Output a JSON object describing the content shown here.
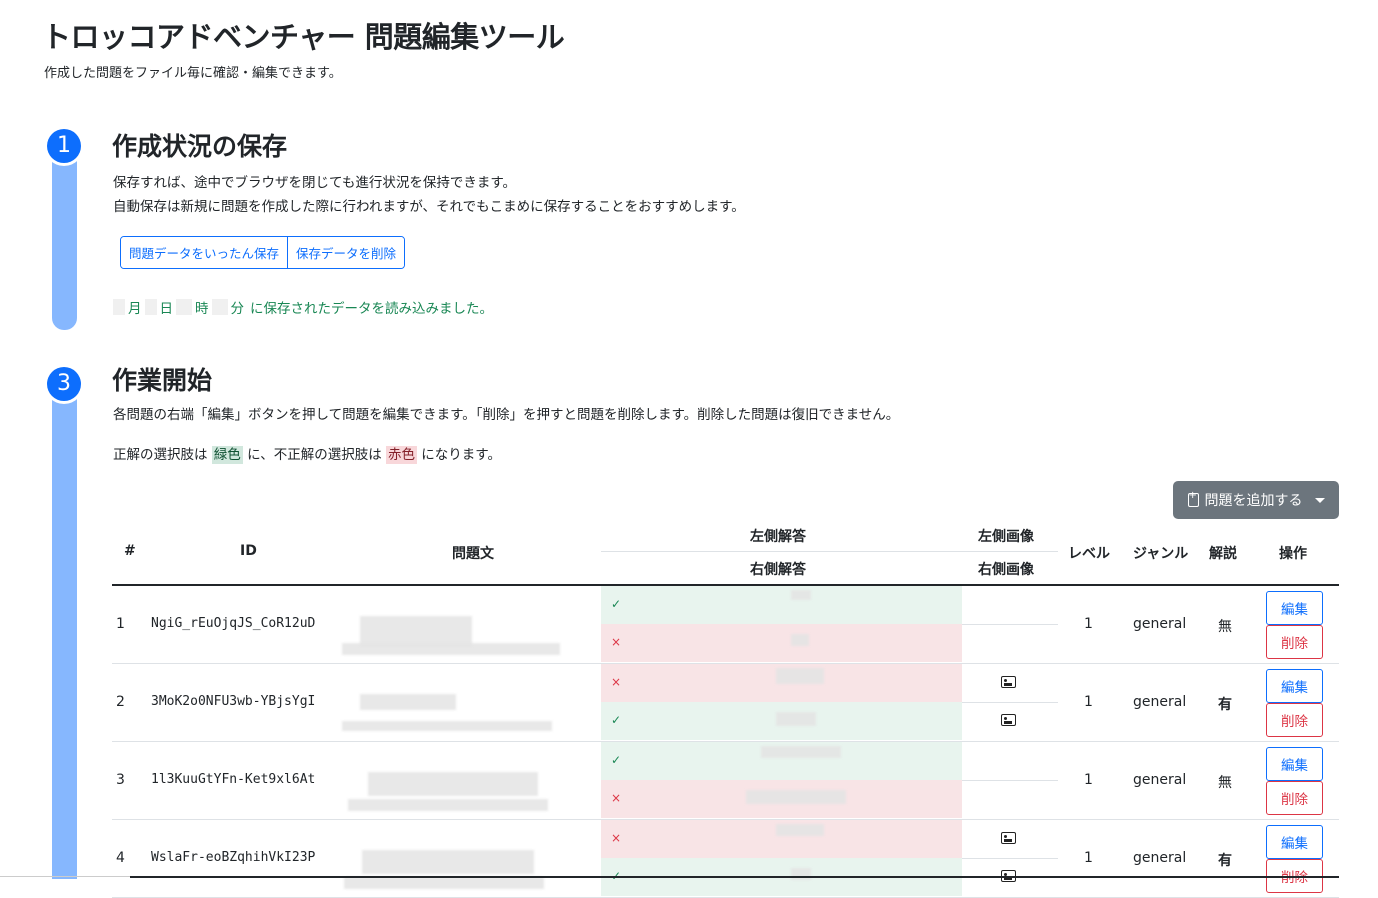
{
  "header": {
    "title": "トロッコアドベンチャー 問題編集ツール",
    "subtitle": "作成した問題をファイル毎に確認・編集できます。"
  },
  "section1": {
    "number": "1",
    "title": "作成状況の保存",
    "desc1": "保存すれば、途中でブラウザを閉じても進行状況を保持できます。",
    "desc2": "自動保存は新規に問題を作成した際に行われますが、それでもこまめに保存することをおすすめします。",
    "save_button": "問題データをいったん保存",
    "delete_button": "保存データを削除",
    "saved_month": "月",
    "saved_day": "日",
    "saved_hour": "時",
    "saved_min": "分",
    "saved_tail": "に保存されたデータを読み込みました。"
  },
  "section3": {
    "number": "3",
    "title": "作業開始",
    "desc1": "各問題の右端「編集」ボタンを押して問題を編集できます。「削除」を押すと問題を削除します。削除した問題は復旧できません。",
    "desc2_a": "正解の選択肢は",
    "green_word": "緑色",
    "desc2_b": "に、不正解の選択肢は",
    "red_word": "赤色",
    "desc2_c": "になります。",
    "add_button": "問題を追加する"
  },
  "table": {
    "headers": {
      "num": "#",
      "id": "ID",
      "question": "問題文",
      "left_answer": "左側解答",
      "right_answer": "右側解答",
      "left_image": "左側画像",
      "right_image": "右側画像",
      "level": "レベル",
      "genre": "ジャンル",
      "explanation": "解説",
      "actions": "操作"
    },
    "edit_label": "編集",
    "delete_label": "削除",
    "correct_mark": "✓",
    "wrong_mark": "×",
    "rows": [
      {
        "num": "1",
        "id": "NgiG_rEuOjqJS_CoR12uD",
        "level": "1",
        "genre": "general",
        "explanation": "無"
      },
      {
        "num": "2",
        "id": "3MoK2o0NFU3wb-YBjsYgI",
        "level": "1",
        "genre": "general",
        "explanation": "有"
      },
      {
        "num": "3",
        "id": "1l3KuuGtYFn-Ket9xl6At",
        "level": "1",
        "genre": "general",
        "explanation": "無"
      },
      {
        "num": "4",
        "id": "WslaFr-eoBZqhihVkI23P",
        "level": "1",
        "genre": "general",
        "explanation": "有"
      }
    ]
  },
  "colors": {
    "primary": "#0d6efd",
    "rail": "#86b7fe",
    "success": "#198754",
    "danger": "#dc3545",
    "secondary": "#6c757d"
  }
}
